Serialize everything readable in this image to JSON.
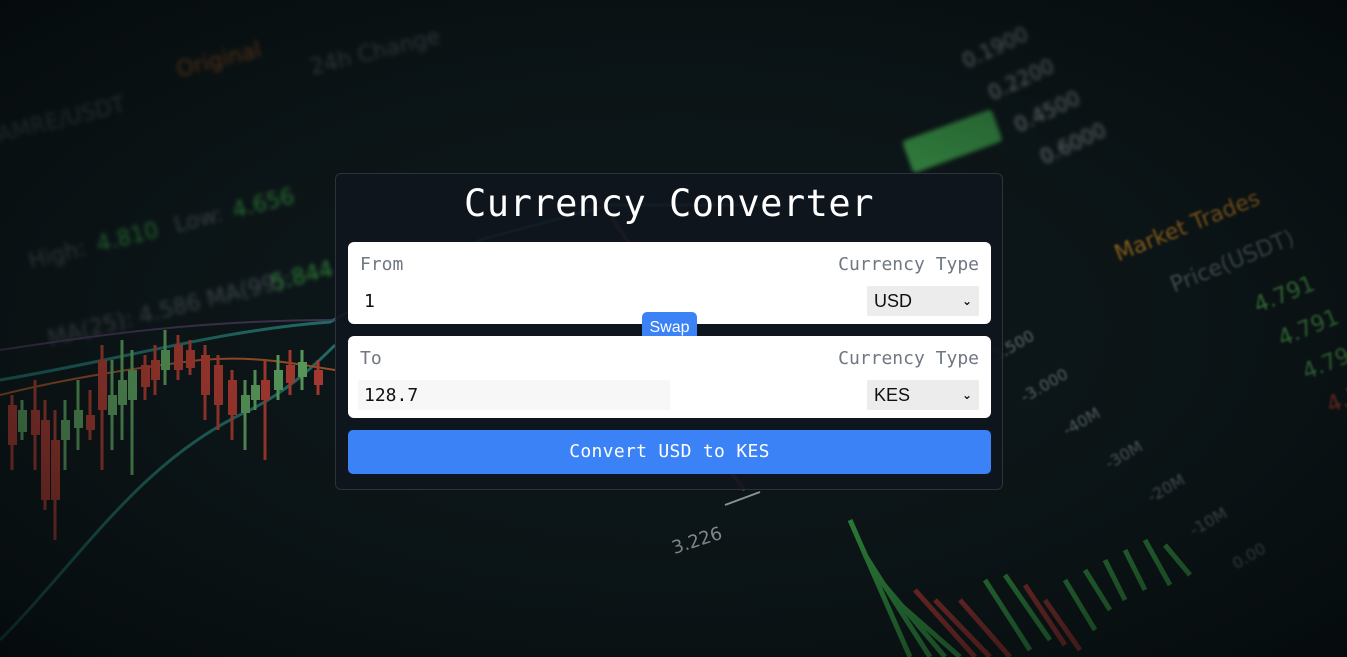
{
  "title": "Currency Converter",
  "from": {
    "label": "From",
    "currency_label": "Currency Type",
    "amount": "1",
    "currency": "USD"
  },
  "to": {
    "label": "To",
    "currency_label": "Currency Type",
    "amount": "128.7",
    "currency": "KES"
  },
  "swap_label": "Swap",
  "convert_label": "Convert USD to KES",
  "colors": {
    "accent": "#3b82f6",
    "card_bg": "#10161e",
    "panel_bg": "#ffffff",
    "candle_up": "#7dd87a",
    "candle_down": "#f04a3a"
  }
}
